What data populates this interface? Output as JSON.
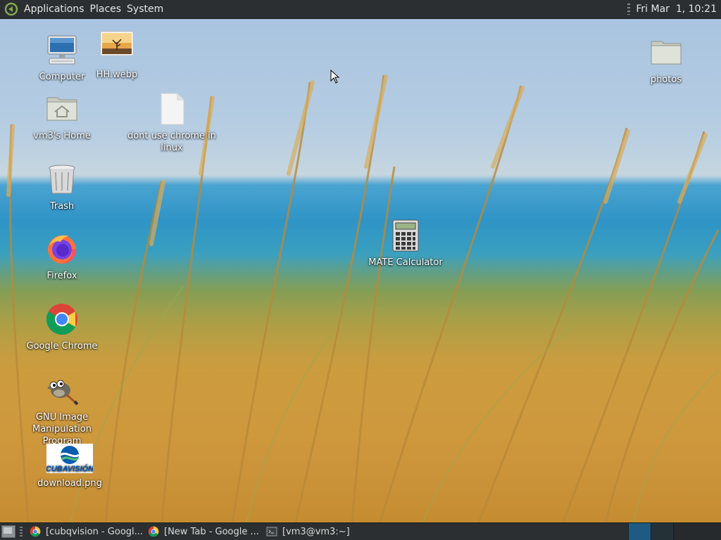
{
  "top_panel": {
    "menus": [
      "Applications",
      "Places",
      "System"
    ],
    "clock": "Fri Mar  1, 10:21"
  },
  "desktop_icons": {
    "computer": "Computer",
    "hh": "HH.webp",
    "photos": "photos",
    "home": "vm3's Home",
    "dont_use": "dont use chrome in linux",
    "trash": "Trash",
    "firefox": "Firefox",
    "calculator": "MATE Calculator",
    "chrome": "Google Chrome",
    "gimp": "GNU Image Manipulation Program",
    "download": "download.png",
    "download_logo_text": "CUBAVISIÓN"
  },
  "taskbar": {
    "tasks": [
      {
        "label": "[cubqvision - Googl...",
        "icon": "chrome-icon"
      },
      {
        "label": "[New Tab - Google ...",
        "icon": "chrome-icon"
      },
      {
        "label": "[vm3@vm3:~]",
        "icon": "terminal-icon"
      }
    ]
  },
  "colors": {
    "panel_bg": "#2b2f31",
    "panel_text": "#e6e6e6",
    "workspace_active": "#1e5a82"
  }
}
